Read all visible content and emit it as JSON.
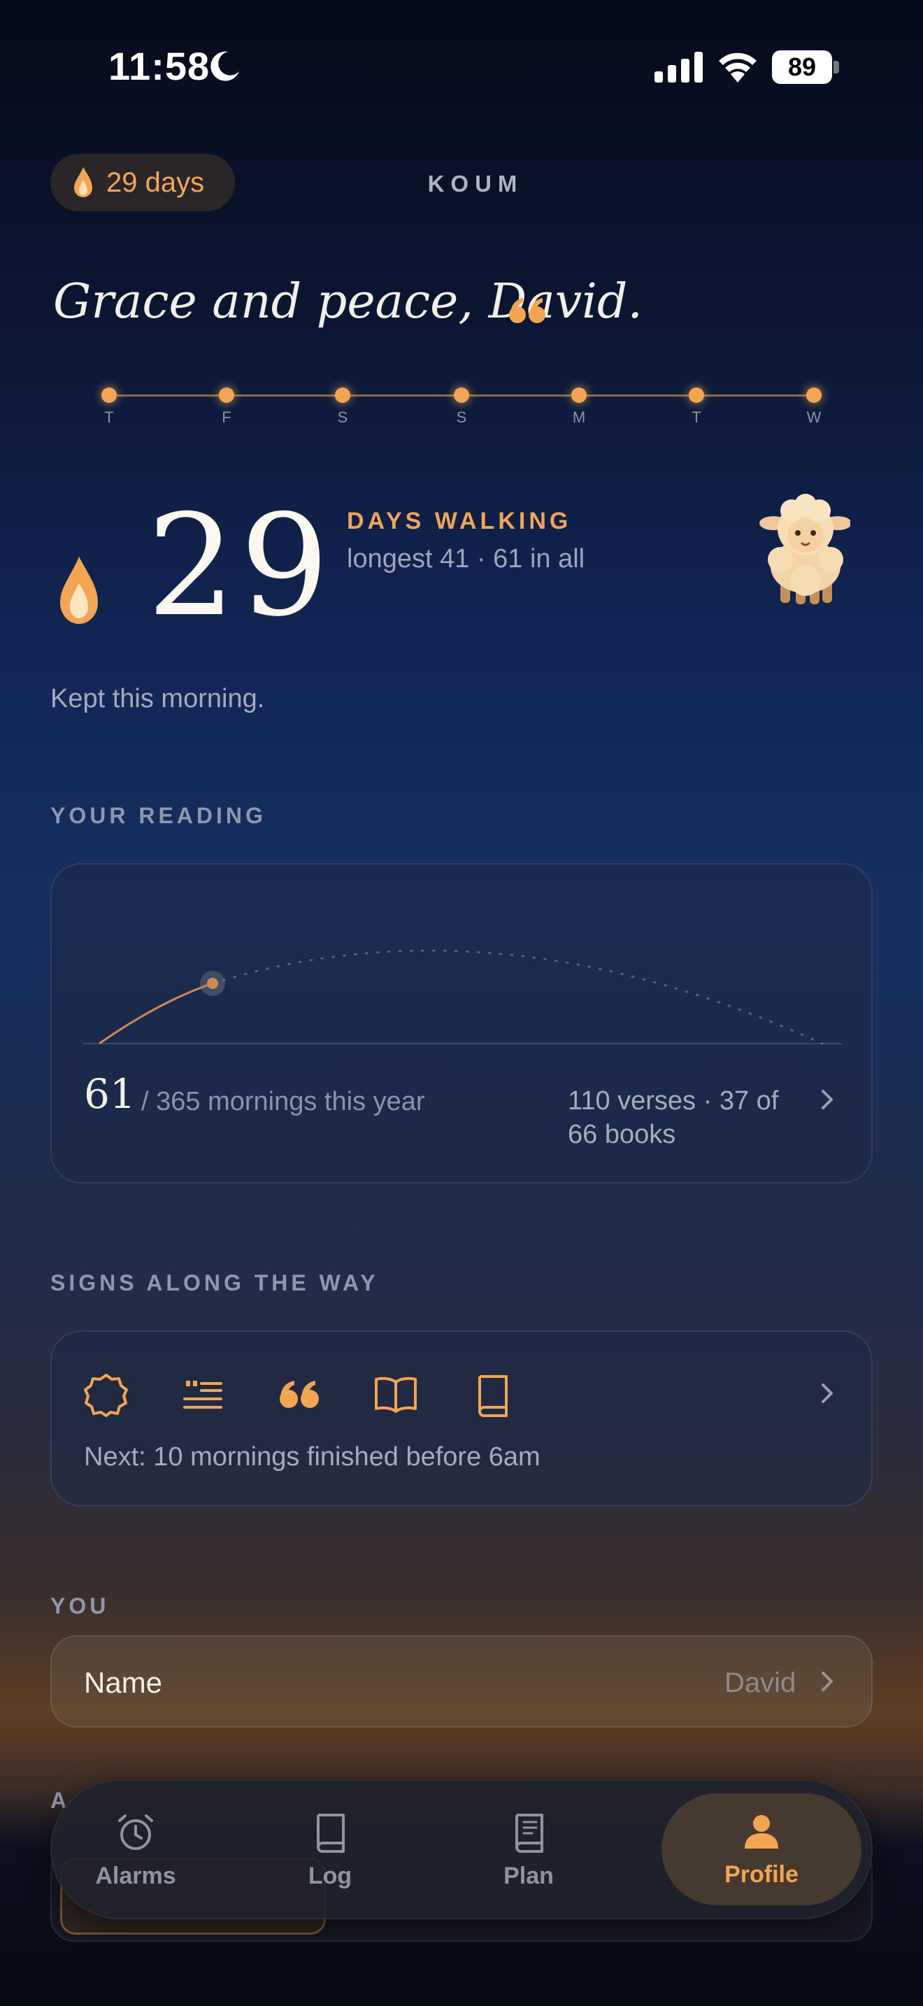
{
  "status_bar": {
    "time": "11:58",
    "battery": "89"
  },
  "header": {
    "streak_pill": "29 days",
    "brand": "KOUM"
  },
  "greeting": "Grace and peace, David.",
  "week": [
    "T",
    "F",
    "S",
    "S",
    "M",
    "T",
    "W"
  ],
  "streak": {
    "count": "29",
    "label": "DAYS WALKING",
    "detail": "longest 41 · 61 in all",
    "status": "Kept this morning."
  },
  "reading": {
    "section_title": "YOUR READING",
    "count": "61",
    "subtitle": "/ 365 mornings this year",
    "stats": "110 verses · 37 of 66 books",
    "progress": 0.167
  },
  "signs": {
    "section_title": "SIGNS ALONG THE WAY",
    "icons": [
      "seal-icon",
      "verse-lines-icon",
      "quote-icon",
      "open-book-icon",
      "book-icon"
    ],
    "next": "Next: 10 mornings finished before 6am"
  },
  "you": {
    "section_title": "YOU",
    "name_label": "Name",
    "name_value": "David"
  },
  "behind_section_title": "A",
  "tabs": [
    {
      "label": "Alarms",
      "icon": "alarm-clock-icon",
      "active": false
    },
    {
      "label": "Log",
      "icon": "book-icon",
      "active": false
    },
    {
      "label": "Plan",
      "icon": "plan-book-icon",
      "active": false
    },
    {
      "label": "Profile",
      "icon": "person-icon",
      "active": true
    }
  ],
  "colors": {
    "accent": "#f3a552",
    "text_muted": "#8f97ab"
  }
}
